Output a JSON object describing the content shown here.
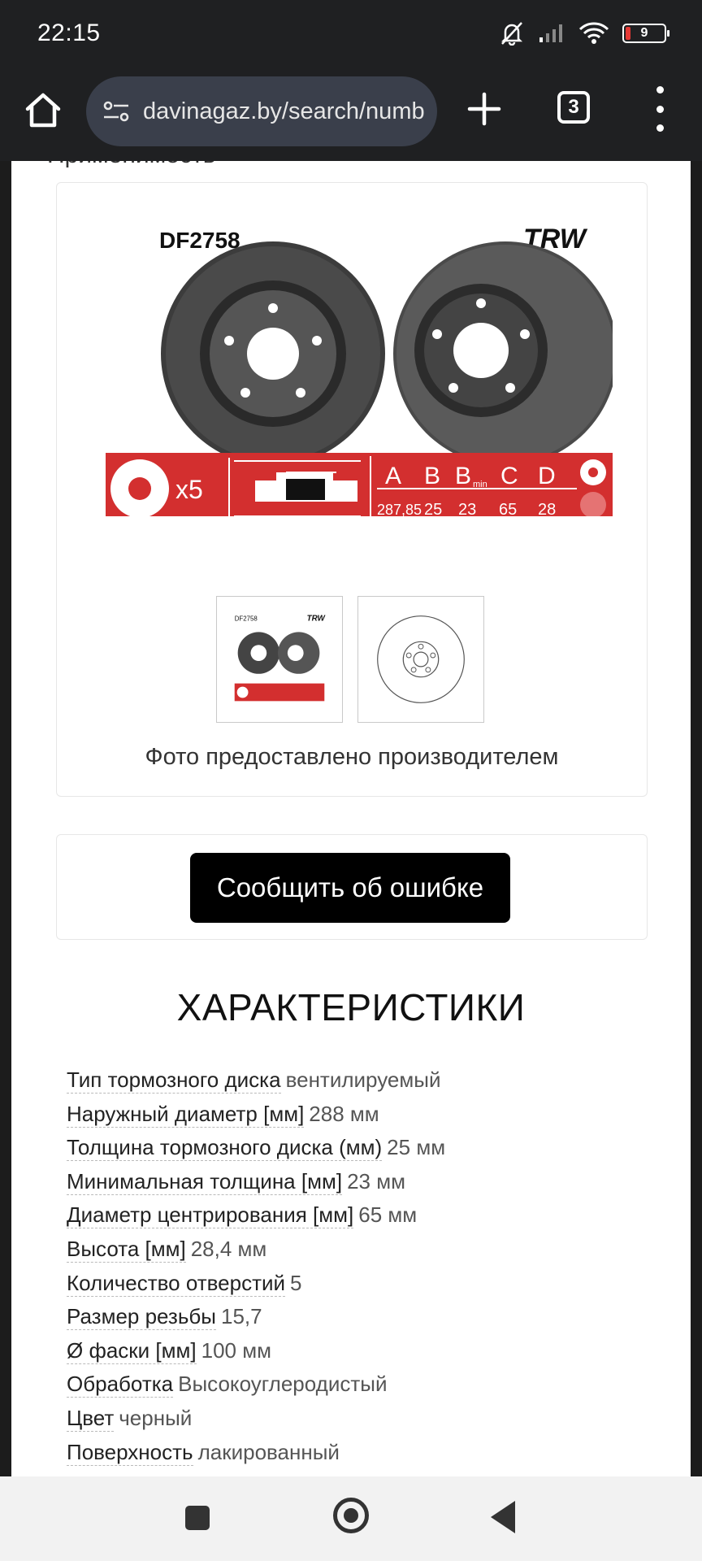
{
  "status_bar": {
    "time": "22:15",
    "battery_level": "9",
    "icons": [
      "mute-bell-icon",
      "signal-icon",
      "wifi-icon",
      "battery-icon"
    ]
  },
  "browser": {
    "url": "davinagaz.by/search/numb",
    "tab_count": "3",
    "icons": [
      "home-icon",
      "site-settings-icon",
      "plus-icon",
      "tabs-icon",
      "menu-icon"
    ]
  },
  "page": {
    "section_header_partial": "Применимость",
    "product_image": {
      "part_number": "DF2758",
      "brand": "TRW",
      "bolts": "x5",
      "dimension_headers": [
        "A",
        "B",
        "B",
        "C",
        "D"
      ],
      "dimension_sub": "min",
      "dimension_values": [
        "287,85",
        "25",
        "23",
        "65",
        "28"
      ],
      "accent_color": "#d32f2f"
    },
    "photo_caption": "Фото предоставлено производителем",
    "report_button": "Сообщить об ошибке",
    "specs_title": "ХАРАКТЕРИСТИКИ",
    "specs": [
      {
        "key": "Тип тормозного диска",
        "value": "вентилируемый"
      },
      {
        "key": "Наружный диаметр [мм]",
        "value": "288 мм"
      },
      {
        "key": "Толщина тормозного диска (мм)",
        "value": "25 мм"
      },
      {
        "key": "Минимальная толщина [мм]",
        "value": "23 мм"
      },
      {
        "key": "Диаметр центрирования [мм]",
        "value": "65 мм"
      },
      {
        "key": "Высота [мм]",
        "value": "28,4 мм"
      },
      {
        "key": "Количество отверстий",
        "value": "5"
      },
      {
        "key": "Размер резьбы",
        "value": "15,7"
      },
      {
        "key": "Ø фаски [мм]",
        "value": "100 мм"
      },
      {
        "key": "Обработка",
        "value": "Высокоуглеродистый"
      },
      {
        "key": "Цвет",
        "value": "черный"
      },
      {
        "key": "Поверхность",
        "value": "лакированный"
      }
    ]
  },
  "nav_bar": {
    "icons": [
      "recents-icon",
      "home-circle-icon",
      "back-icon"
    ]
  }
}
